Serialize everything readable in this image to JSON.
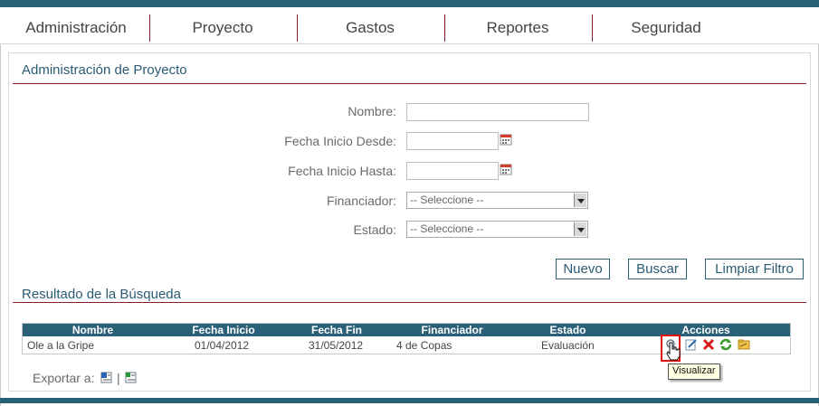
{
  "nav": {
    "items": [
      "Administración",
      "Proyecto",
      "Gastos",
      "Reportes",
      "Seguridad"
    ]
  },
  "page": {
    "title": "Administración de Proyecto",
    "results_title": "Resultado de la Búsqueda"
  },
  "form": {
    "nombre_label": "Nombre:",
    "nombre_value": "",
    "fecha_desde_label": "Fecha Inicio Desde:",
    "fecha_desde_value": "",
    "fecha_hasta_label": "Fecha Inicio Hasta:",
    "fecha_hasta_value": "",
    "financiador_label": "Financiador:",
    "financiador_selected": "-- Seleccione --",
    "estado_label": "Estado:",
    "estado_selected": "-- Seleccione --"
  },
  "buttons": {
    "nuevo": "Nuevo",
    "buscar": "Buscar",
    "limpiar": "Limpiar Filtro"
  },
  "table": {
    "columns": [
      "Nombre",
      "Fecha Inicio",
      "Fecha Fin",
      "Financiador",
      "Estado",
      "Acciones"
    ],
    "rows": [
      {
        "nombre": "Ole a la Gripe",
        "fecha_inicio": "01/04/2012",
        "fecha_fin": "31/05/2012",
        "financiador": "4 de Copas",
        "estado": "Evaluación"
      }
    ]
  },
  "actions": {
    "icons": [
      "view-icon",
      "edit-icon",
      "delete-icon",
      "refresh-icon",
      "folder-icon"
    ],
    "tooltip": "Visualizar"
  },
  "export": {
    "label": "Exportar a:",
    "separator": "|"
  },
  "colors": {
    "brand": "#2b6079",
    "accent": "#8b1c2c",
    "highlight": "#e01010"
  }
}
